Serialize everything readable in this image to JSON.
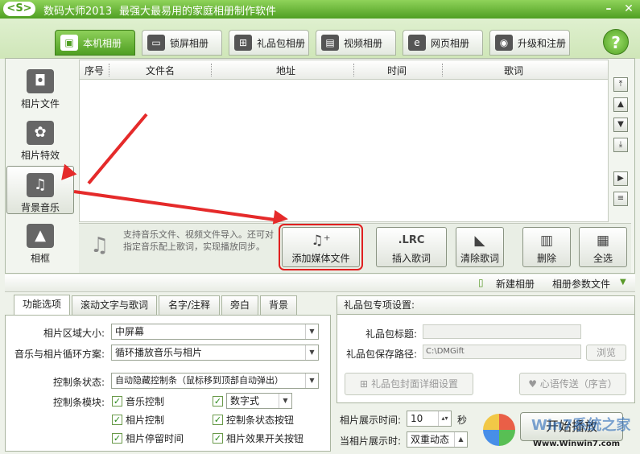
{
  "app": {
    "logo": "<S>",
    "title": "数码大师2013",
    "slogan": "最强大最易用的家庭相册制作软件",
    "win_min": "–",
    "win_close": "✕"
  },
  "tabs": [
    {
      "label": "本机相册",
      "icon": "▣"
    },
    {
      "label": "锁屏相册",
      "icon": "▭"
    },
    {
      "label": "礼品包相册",
      "icon": "⊞"
    },
    {
      "label": "视频相册",
      "icon": "▤"
    },
    {
      "label": "网页相册",
      "icon": "e"
    },
    {
      "label": "升级和注册",
      "icon": "◉"
    }
  ],
  "help": "?",
  "sidebar": [
    {
      "label": "相片文件",
      "icon": "◘"
    },
    {
      "label": "相片特效",
      "icon": "✿"
    },
    {
      "label": "背景音乐",
      "icon": "♫"
    },
    {
      "label": "相框",
      "icon": "▲"
    }
  ],
  "table": {
    "columns": [
      "序号",
      "文件名",
      "地址",
      "时间",
      "歌词"
    ]
  },
  "scroll": [
    "⤒",
    "▲",
    "▼",
    "⤓",
    "▶",
    "≡"
  ],
  "hint": "支持音乐文件、视频文件导入。还可对指定音乐配上歌词，实现播放同步。",
  "hint_icon": "♫",
  "actions": [
    {
      "label": "添加媒体文件",
      "icon": "♫⁺"
    },
    {
      "label": "插入歌词",
      "icon": ".LRC"
    },
    {
      "label": "清除歌词",
      "icon": "◣"
    },
    {
      "label": "删除",
      "icon": "▥"
    },
    {
      "label": "全选",
      "icon": "▦"
    }
  ],
  "midbar": {
    "new_album": "新建相册",
    "params": "相册参数文件",
    "doc_icon": "▯",
    "dropdown_icon": "▼"
  },
  "bottom_tabs": [
    "功能选项",
    "滚动文字与歌词",
    "名字/注释",
    "旁白",
    "背景"
  ],
  "options": {
    "area_label": "相片区域大小:",
    "area_value": "中屏幕",
    "loop_label": "音乐与相片循环方案:",
    "loop_value": "循环播放音乐与相片",
    "ctrl_label": "控制条状态:",
    "ctrl_value": "自动隐藏控制条（鼠标移到顶部自动弹出）",
    "module_label": "控制条模块:",
    "modules": [
      "音乐控制",
      "数字式",
      "相片控制",
      "控制条状态按钮",
      "相片停留时间",
      "相片效果开关按钮"
    ],
    "check_mark": "✓",
    "arrow": "▼"
  },
  "gift": {
    "header": "礼品包专项设置:",
    "title_label": "礼品包标题:",
    "path_label": "礼品包保存路径:",
    "path_value": "C:\\DMGift",
    "browse": "浏览",
    "cover_btn": "礼品包封面详细设置",
    "wish_btn": "心语传送（序言）",
    "cover_icon": "⊞",
    "wish_icon": "♥"
  },
  "timing": {
    "show_label": "相片展示时间:",
    "show_value": "10",
    "unit": "秒",
    "when_label": "当相片展示时:",
    "when_value": "双重动态",
    "spin": "▴▾",
    "up": "▲"
  },
  "play": "开始播放",
  "watermark": {
    "brand": "Win7系统之家",
    "url": "Www.Winwin7.com"
  }
}
